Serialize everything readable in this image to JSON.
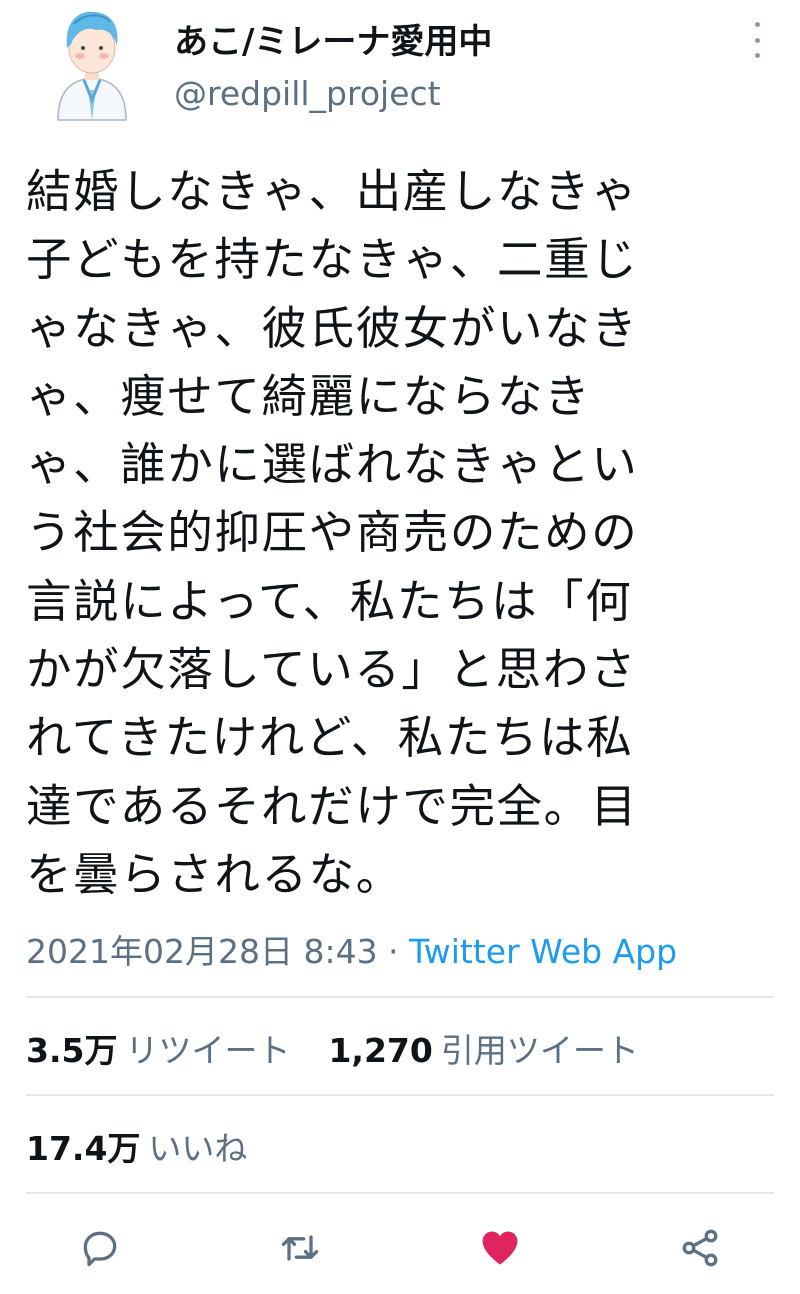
{
  "author": {
    "name": "あこ/ミレーナ愛用中",
    "handle": "@redpill_project"
  },
  "tweet": {
    "lines": [
      "結婚しなきゃ、出産しなきゃ",
      "子どもを持たなきゃ、二重じ",
      "ゃなきゃ、彼氏彼女がいなき",
      "ゃ、痩せて綺麗にならなき",
      "ゃ、誰かに選ばれなきゃとい",
      "う社会的抑圧や商売のための",
      "言説によって、私たちは「何",
      "かが欠落している」と思わさ",
      "れてきたけれど、私たちは私",
      "達であるそれだけで完全。目",
      "を曇らされるな。"
    ],
    "timestamp": "2021年02月28日 8:43",
    "separator": " · ",
    "source": "Twitter Web App"
  },
  "stats": {
    "retweets_count": "3.5万",
    "retweets_label": "リツイート",
    "quotes_count": "1,270",
    "quotes_label": "引用ツイート",
    "likes_count": "17.4万",
    "likes_label": "いいね"
  },
  "icons": {
    "more": "more-vertical-icon",
    "reply": "reply-icon",
    "retweet": "retweet-icon",
    "like": "heart-icon",
    "share": "share-icon"
  },
  "colors": {
    "accent": "#1d9bf0",
    "like": "#e0245e",
    "muted": "#5b7083",
    "divider": "#e3e7ea"
  }
}
